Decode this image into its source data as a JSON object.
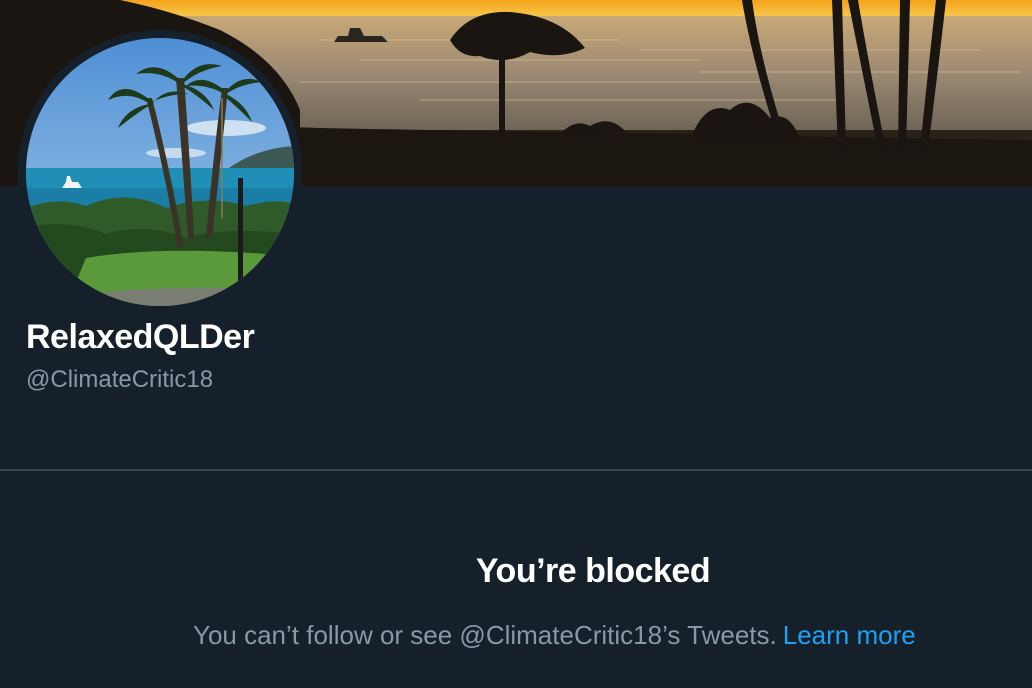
{
  "profile": {
    "display_name": "RelaxedQLDer",
    "handle": "@ClimateCritic18"
  },
  "blocked": {
    "title": "You’re blocked",
    "message": "You can’t follow or see @ClimateCritic18’s Tweets.",
    "learn_more_label": "Learn more"
  },
  "theme": {
    "background": "#15202b",
    "divider": "#38444d",
    "primary_text": "#ffffff",
    "secondary_text": "#8899a6",
    "link": "#1da1f2"
  }
}
